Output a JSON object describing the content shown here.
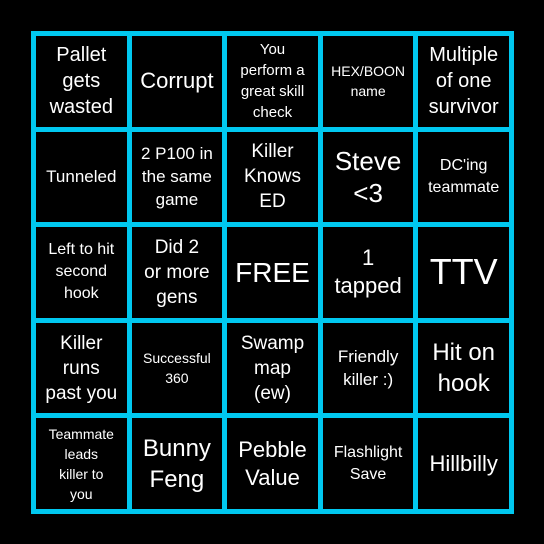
{
  "board": {
    "border_color": "#00c8f0",
    "background_color": "#000000",
    "text_color": "#ffffff",
    "rows": [
      [
        "Pallet\ngets\nwasted",
        "Corrupt",
        "You\nperform a\ngreat skill\ncheck",
        "HEX/BOON\nname",
        "Multiple\nof one\nsurvivor"
      ],
      [
        "Tunneled",
        "2 P100 in\nthe same\ngame",
        "Killer\nKnows\nED",
        "Steve\n<3",
        "DC'ing\nteammate"
      ],
      [
        "Left to hit\nsecond\nhook",
        "Did 2\nor more\ngens",
        "FREE",
        "1\ntapped",
        "TTV"
      ],
      [
        "Killer\nruns\npast you",
        "Successful\n360",
        "Swamp\nmap\n(ew)",
        "Friendly\nkiller :)",
        "Hit on\nhook"
      ],
      [
        "Teammate\nleads\nkiller to\nyou",
        "Bunny\nFeng",
        "Pebble\nValue",
        "Flashlight\nSave",
        "Hillbilly"
      ]
    ]
  }
}
